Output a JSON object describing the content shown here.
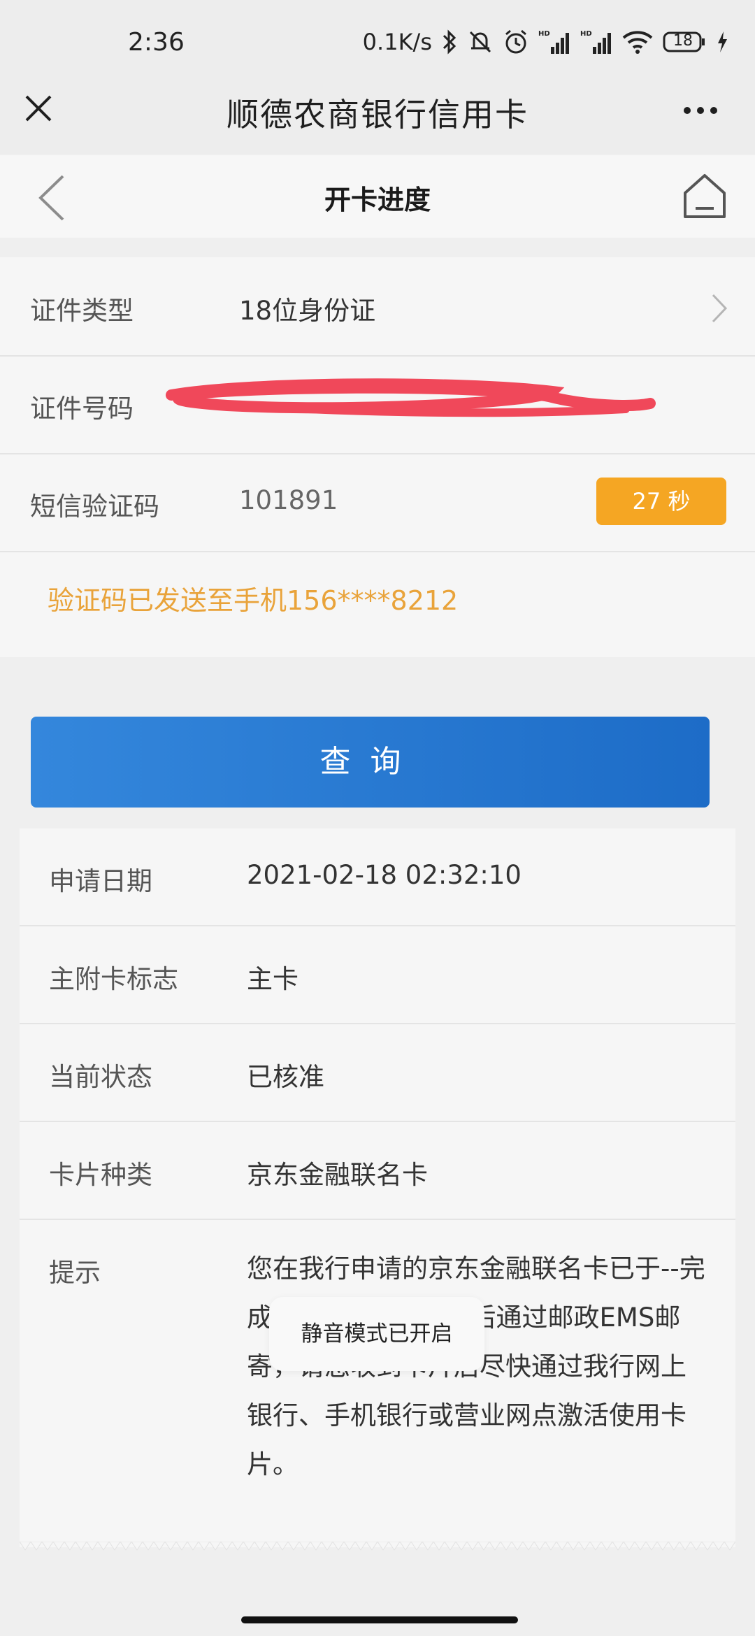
{
  "status_bar": {
    "time": "2:36",
    "net_speed": "0.1K/s",
    "battery": "18"
  },
  "titlebar": {
    "title": "顺德农商银行信用卡"
  },
  "nav": {
    "title": "开卡进度"
  },
  "form": {
    "id_type_label": "证件类型",
    "id_type_value": "18位身份证",
    "id_number_label": "证件号码",
    "sms_label": "短信验证码",
    "sms_value": "101891",
    "timer_label": "27 秒",
    "sms_note": "验证码已发送至手机156****8212"
  },
  "query_button": "查询",
  "result": {
    "rows": [
      {
        "label": "申请日期",
        "value": "2021-02-18 02:32:10"
      },
      {
        "label": "主附卡标志",
        "value": "主卡"
      },
      {
        "label": "当前状态",
        "value": "已核准"
      },
      {
        "label": "卡片种类",
        "value": "京东金融联名卡"
      }
    ],
    "tip_label": "提示",
    "tip_text": "您在我行申请的京东金融联名卡已于--完成，将于7个工作日后通过邮政EMS邮寄，请您收到卡片后尽快通过我行网上银行、手机银行或营业网点激活使用卡片。"
  },
  "toast": "静音模式已开启",
  "colors": {
    "accent_blue": "#1d6cc7",
    "timer_orange": "#f5a623",
    "note_orange": "#e9a33a"
  }
}
